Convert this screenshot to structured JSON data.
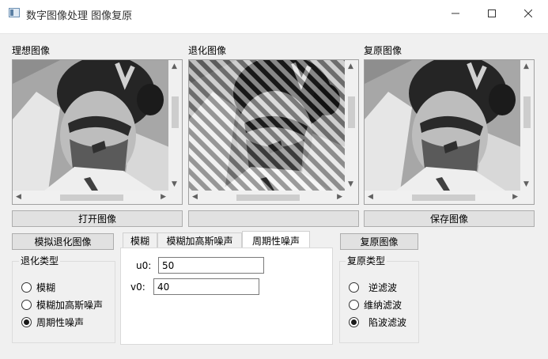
{
  "window": {
    "title": "数字图像处理 图像复原",
    "controls": {
      "minimize": "—",
      "maximize": "☐",
      "close": "✕"
    }
  },
  "panels": [
    {
      "label": "理想图像",
      "degraded": false
    },
    {
      "label": "退化图像",
      "degraded": true
    },
    {
      "label": "复原图像",
      "degraded": false
    }
  ],
  "buttons": {
    "open": "打开图像",
    "middle": "",
    "save": "保存图像",
    "simulate": "模拟退化图像",
    "restore": "复原图像"
  },
  "degrade_group": {
    "title": "退化类型",
    "options": [
      {
        "label": "模糊",
        "selected": false
      },
      {
        "label": "模糊加高斯噪声",
        "selected": false
      },
      {
        "label": "周期性噪声",
        "selected": true
      }
    ]
  },
  "tabs": {
    "items": [
      {
        "label": "模糊",
        "active": false
      },
      {
        "label": "模糊加高斯噪声",
        "active": false
      },
      {
        "label": "周期性噪声",
        "active": true
      }
    ],
    "fields": [
      {
        "label": "u0:",
        "value": "50"
      },
      {
        "label": "v0:",
        "value": "40"
      }
    ]
  },
  "restore_group": {
    "title": "复原类型",
    "options": [
      {
        "label": "逆滤波",
        "selected": false
      },
      {
        "label": "维纳滤波",
        "selected": false
      },
      {
        "label": "陷波滤波",
        "selected": true
      }
    ]
  }
}
